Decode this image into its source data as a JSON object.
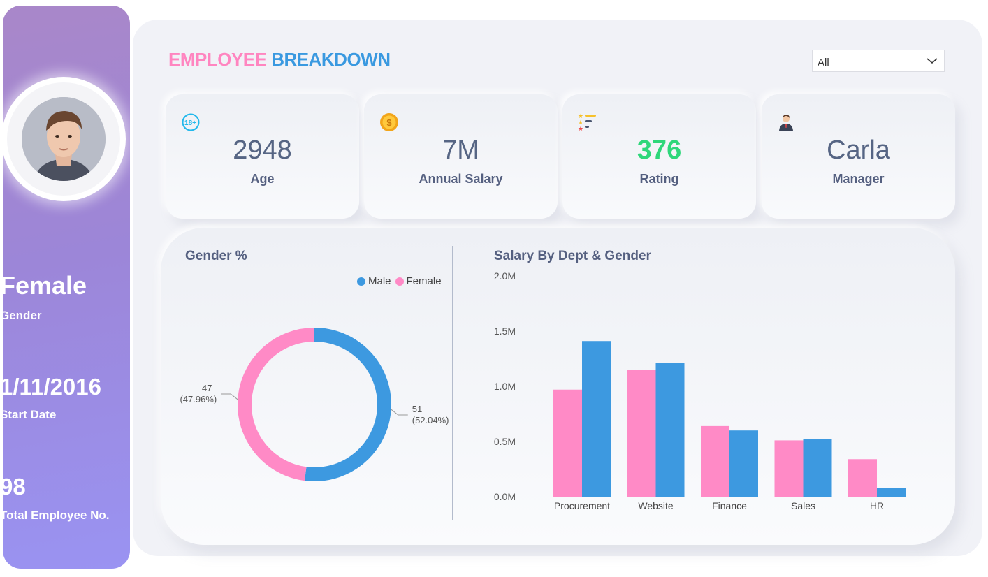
{
  "sidebar": {
    "gender_value": "Female",
    "gender_label": "Gender",
    "start_date_value": "1/11/2016",
    "start_date_label": "Start Date",
    "total_value": "98",
    "total_label": "Total Employee No."
  },
  "header": {
    "title_part1": "EMPLOYEE",
    "title_part2": "BREAKDOWN",
    "filter_value": "All"
  },
  "kpis": [
    {
      "value": "2948",
      "label": "Age",
      "icon": "age-18-plus-icon"
    },
    {
      "value": "7M",
      "label": "Annual Salary",
      "icon": "coin-icon"
    },
    {
      "value": "376",
      "label": "Rating",
      "icon": "rating-stars-icon"
    },
    {
      "value": "Carla",
      "label": "Manager",
      "icon": "manager-person-icon"
    }
  ],
  "colors": {
    "male": "#3d99e0",
    "female": "#ff8ac6",
    "rating_value": "#2ed77a",
    "title_pink": "#ff85c0",
    "title_blue": "#3a99e0"
  },
  "chart_data": [
    {
      "type": "pie",
      "title": "Gender %",
      "series": [
        {
          "name": "Male",
          "value": 51,
          "label": "(52.04%)"
        },
        {
          "name": "Female",
          "value": 47,
          "label": "(47.96%)"
        }
      ],
      "legend": "top-right",
      "donut": true
    },
    {
      "type": "bar",
      "title": "Salary By Dept & Gender",
      "categories": [
        "Procurement",
        "Website",
        "Finance",
        "Sales",
        "HR"
      ],
      "series": [
        {
          "name": "Female",
          "values": [
            0.97,
            1.15,
            0.64,
            0.51,
            0.34
          ]
        },
        {
          "name": "Male",
          "values": [
            1.41,
            1.21,
            0.6,
            0.52,
            0.08
          ]
        }
      ],
      "yticks": [
        "0.0M",
        "0.5M",
        "1.0M",
        "1.5M",
        "2.0M"
      ],
      "ylim": [
        0,
        2.0
      ],
      "yunit": "M",
      "grid": false
    }
  ]
}
